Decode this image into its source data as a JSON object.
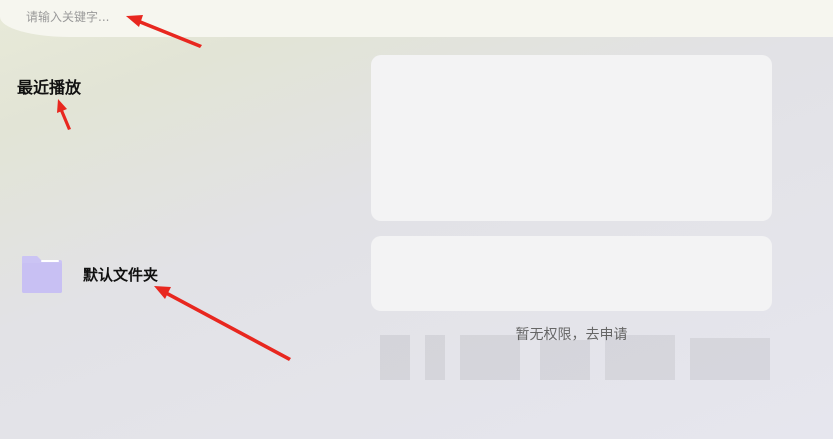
{
  "search": {
    "placeholder": "请输入关键字..."
  },
  "recent": {
    "title": "最近播放"
  },
  "folder": {
    "label": "默认文件夹",
    "icon": "folder-icon",
    "icon_color": "#cbc4f4"
  },
  "permission": {
    "text": "暂无权限，去申请"
  },
  "annotation_color": "#e8271f"
}
